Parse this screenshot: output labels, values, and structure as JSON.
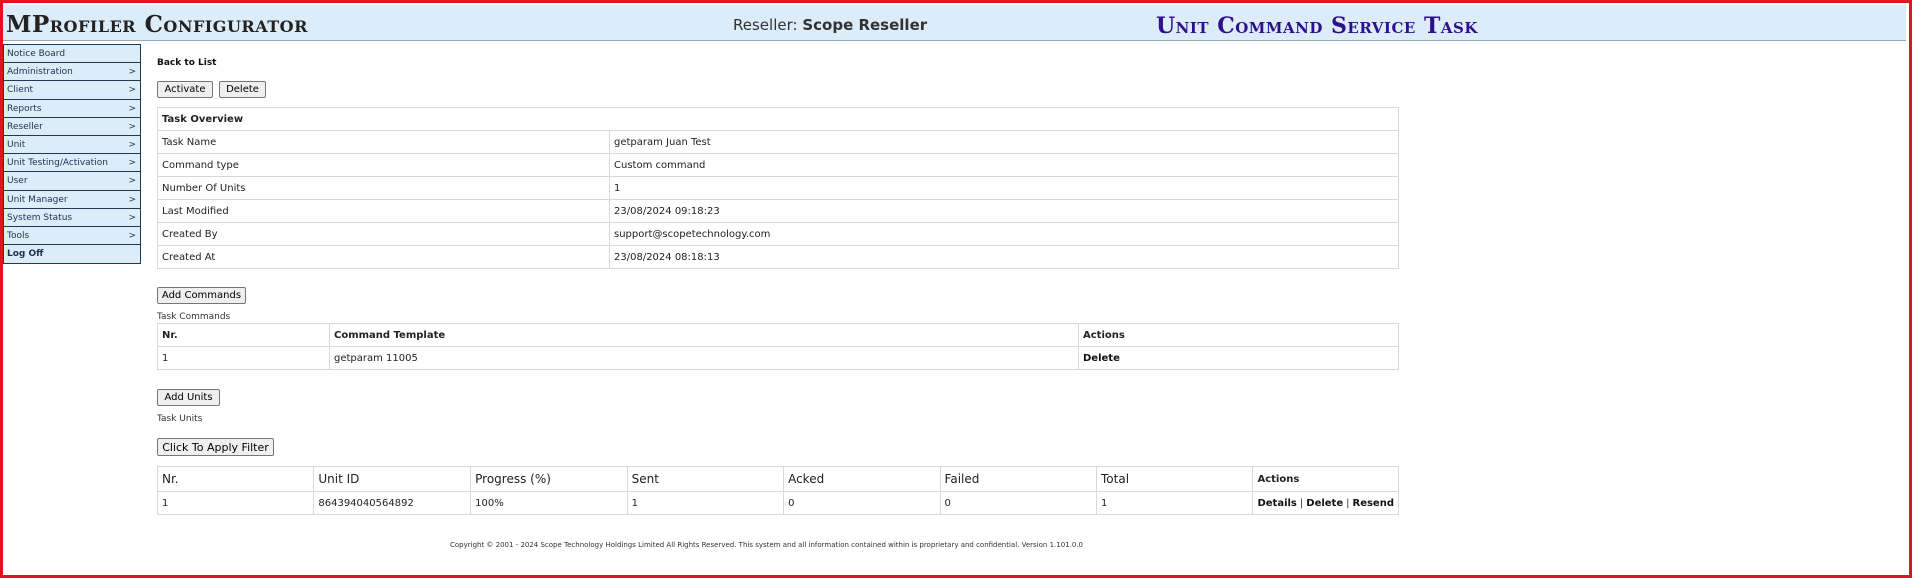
{
  "header": {
    "app_title": "MProfiler Configurator",
    "reseller_label": "Reseller:",
    "reseller_name": "Scope Reseller",
    "page_heading": "Unit Command Service Task"
  },
  "sidebar": {
    "items": [
      {
        "label": "Notice Board",
        "arrow": ""
      },
      {
        "label": "Administration",
        "arrow": ">"
      },
      {
        "label": "Client",
        "arrow": ">"
      },
      {
        "label": "Reports",
        "arrow": ">"
      },
      {
        "label": "Reseller",
        "arrow": ">"
      },
      {
        "label": "Unit",
        "arrow": ">"
      },
      {
        "label": "Unit Testing/Activation",
        "arrow": ">"
      },
      {
        "label": "User",
        "arrow": ">"
      },
      {
        "label": "Unit Manager",
        "arrow": ">"
      },
      {
        "label": "System Status",
        "arrow": ">"
      },
      {
        "label": "Tools",
        "arrow": ">"
      },
      {
        "label": "Log Off",
        "arrow": ""
      }
    ]
  },
  "main": {
    "back_link": "Back to List",
    "activate_button": "Activate",
    "delete_button": "Delete",
    "overview": {
      "title": "Task Overview",
      "rows": [
        {
          "label": "Task Name",
          "value": "getparam Juan Test"
        },
        {
          "label": "Command type",
          "value": "Custom command"
        },
        {
          "label": "Number Of Units",
          "value": "1"
        },
        {
          "label": "Last Modified",
          "value": "23/08/2024 09:18:23"
        },
        {
          "label": "Created By",
          "value": "support@scopetechnology.com"
        },
        {
          "label": "Created At",
          "value": "23/08/2024 08:18:13"
        }
      ]
    },
    "add_commands_button": "Add Commands",
    "task_commands_label": "Task Commands",
    "commands": {
      "headers": [
        "Nr.",
        "Command Template",
        "Actions"
      ],
      "rows": [
        {
          "nr": "1",
          "template": "getparam 11005",
          "action": "Delete"
        }
      ]
    },
    "add_units_button": "Add Units",
    "task_units_label": "Task Units",
    "filter_button": "Click To Apply Filter",
    "units": {
      "headers": [
        "Nr.",
        "Unit ID",
        "Progress (%)",
        "Sent",
        "Acked",
        "Failed",
        "Total",
        "Actions"
      ],
      "rows": [
        {
          "nr": "1",
          "unit_id": "864394040564892",
          "progress": "100%",
          "sent": "1",
          "acked": "0",
          "failed": "0",
          "total": "1",
          "actions": [
            "Details",
            "Delete",
            "Resend"
          ]
        }
      ]
    }
  },
  "footer": {
    "copyright": "Copyright © 2001 - 2024 Scope Technology Holdings Limited All Rights Reserved. This system and all information contained within is proprietary and confidential. Version 1.101.0.0"
  },
  "colors": {
    "frame_border": "#e0141c",
    "header_bg": "#dcecf9",
    "page_heading": "#2e0f8c",
    "sidebar_border": "#1e3a57"
  }
}
